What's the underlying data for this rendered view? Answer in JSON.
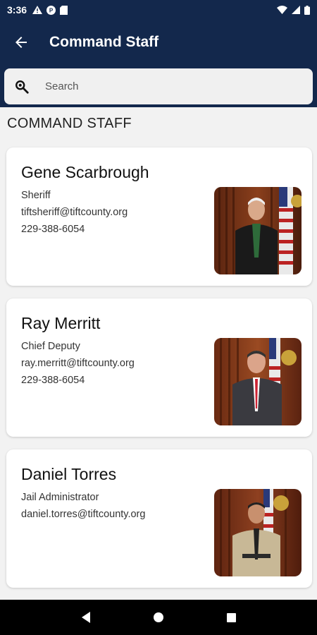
{
  "status_bar": {
    "time": "3:36",
    "left_icons": [
      "alert-icon",
      "app-icon",
      "sd-card-icon"
    ],
    "right_icons": [
      "wifi-icon",
      "signal-icon",
      "battery-icon"
    ]
  },
  "appbar": {
    "title": "Command Staff",
    "back_icon": "arrow-left-icon"
  },
  "search": {
    "placeholder": "Search",
    "icon": "search-icon"
  },
  "section": {
    "title": "COMMAND STAFF"
  },
  "staff": [
    {
      "name": "Gene Scarbrough",
      "role": "Sheriff",
      "email": "tiftsheriff@tiftcounty.org",
      "phone": "229-388-6054"
    },
    {
      "name": "Ray Merritt",
      "role": "Chief Deputy",
      "email": "ray.merritt@tiftcounty.org",
      "phone": "229-388-6054"
    },
    {
      "name": "Daniel Torres",
      "role": "Jail Administrator",
      "email": "daniel.torres@tiftcounty.org",
      "phone": ""
    }
  ],
  "colors": {
    "header": "#13284c",
    "background": "#f2f2f2",
    "card": "#ffffff"
  }
}
